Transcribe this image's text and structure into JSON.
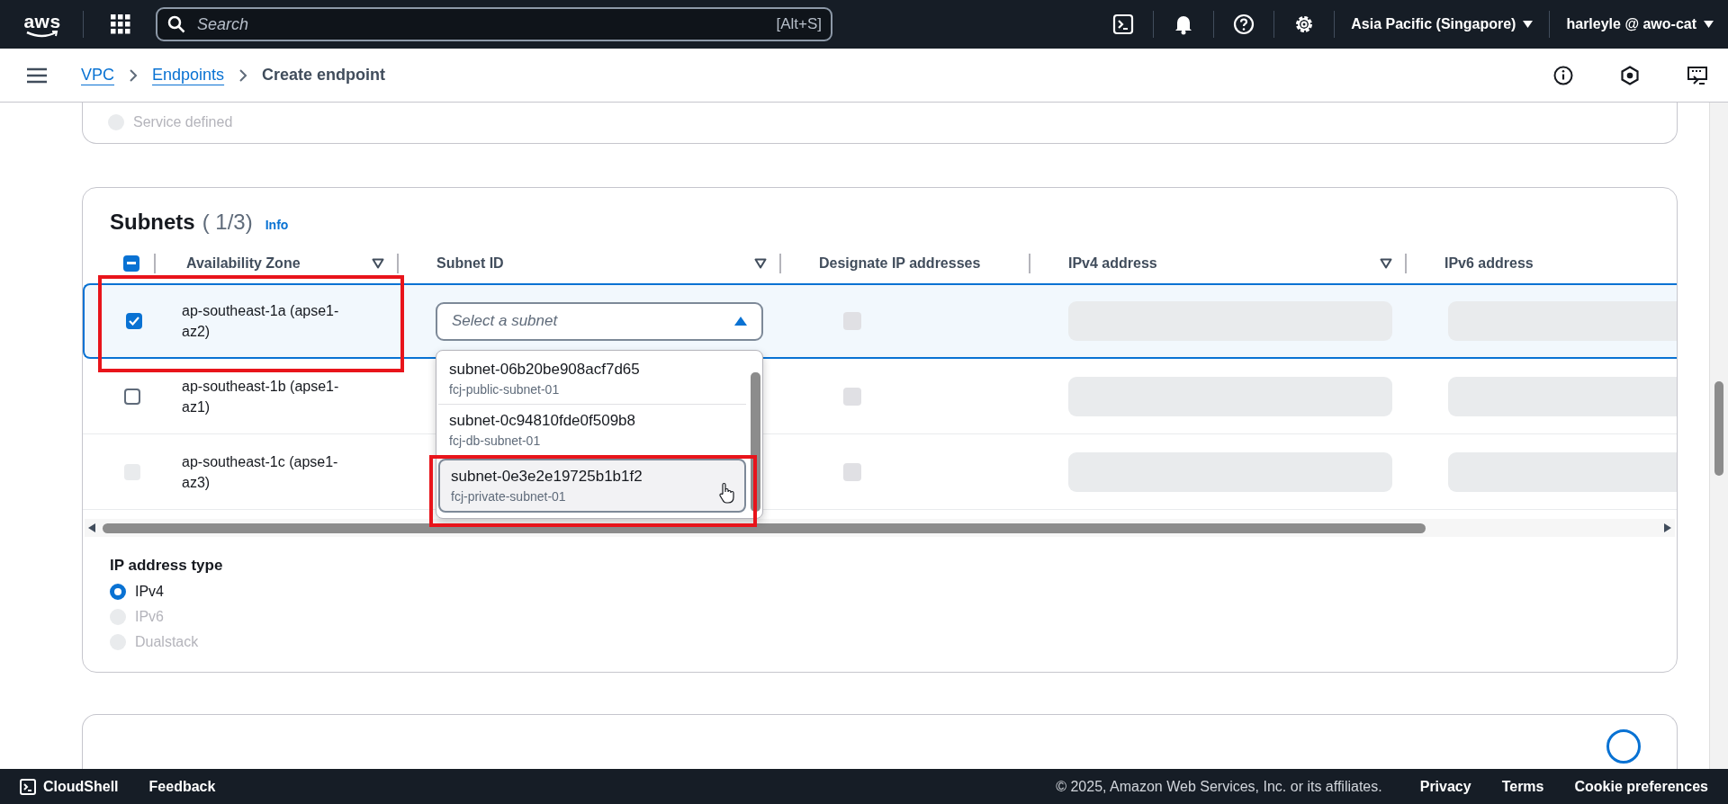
{
  "top_nav": {
    "logo": "aws",
    "search": {
      "placeholder": "Search",
      "shortcut": "[Alt+S]"
    },
    "region": "Asia Pacific (Singapore)",
    "user": "harleyle @ awo-cat"
  },
  "breadcrumb": {
    "links": [
      "VPC",
      "Endpoints"
    ],
    "current": "Create endpoint"
  },
  "previous_section": {
    "options": [
      {
        "label": "Service defined",
        "selected": false,
        "disabled": true
      }
    ]
  },
  "subnets": {
    "title": "Subnets",
    "count": "( 1/3)",
    "info": "Info",
    "select_all": {
      "indeterminate": true
    },
    "columns": [
      {
        "label": "Availability Zone",
        "sortable": true
      },
      {
        "label": "Subnet ID",
        "sortable": true
      },
      {
        "label": "Designate IP addresses",
        "sortable": false
      },
      {
        "label": "IPv4 address",
        "sortable": true
      },
      {
        "label": "IPv6 address",
        "sortable": false
      }
    ],
    "rows": [
      {
        "zone": "ap-southeast-1a (apse1-az2)",
        "selected": true,
        "disabled": false,
        "highlighted": true,
        "designate_ip": {
          "disabled": true
        }
      },
      {
        "zone": "ap-southeast-1b (apse1-az1)",
        "selected": false,
        "disabled": false,
        "highlighted": false,
        "designate_ip": {
          "disabled": true
        }
      },
      {
        "zone": "ap-southeast-1c (apse1-az3)",
        "selected": false,
        "disabled": true,
        "highlighted": false,
        "designate_ip": {
          "disabled": true
        }
      }
    ],
    "subnet_select": {
      "placeholder": "Select a subnet",
      "expanded": true,
      "options": [
        {
          "id": "subnet-06b20be908acf7d65",
          "name": "fcj-public-subnet-01",
          "hovered": false,
          "highlighted": false
        },
        {
          "id": "subnet-0c94810fde0f509b8",
          "name": "fcj-db-subnet-01",
          "hovered": false,
          "highlighted": false
        },
        {
          "id": "subnet-0e3e2e19725b1b1f2",
          "name": "fcj-private-subnet-01",
          "hovered": true,
          "highlighted": true
        }
      ]
    },
    "ip_address_type": {
      "label": "IP address type",
      "options": [
        {
          "label": "IPv4",
          "selected": true,
          "disabled": false
        },
        {
          "label": "IPv6",
          "selected": false,
          "disabled": true
        },
        {
          "label": "Dualstack",
          "selected": false,
          "disabled": true
        }
      ]
    }
  },
  "footer": {
    "cloudshell": "CloudShell",
    "feedback": "Feedback",
    "copyright": "© 2025, Amazon Web Services, Inc. or its affiliates.",
    "links": [
      "Privacy",
      "Terms",
      "Cookie preferences"
    ]
  }
}
